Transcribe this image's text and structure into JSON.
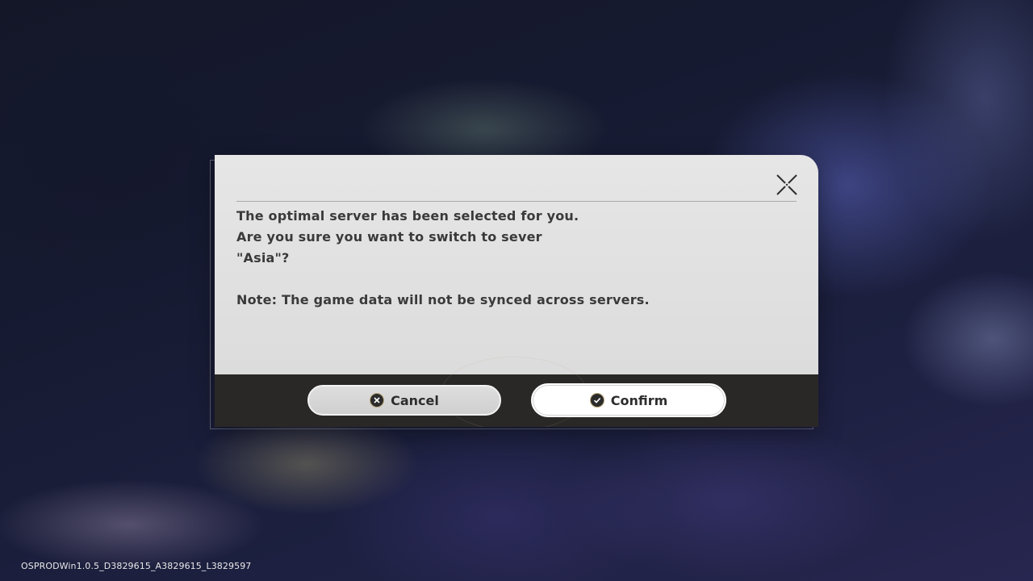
{
  "dialog": {
    "message_lines": [
      "The optimal server has been selected for you.",
      "Are you sure you want to switch to sever",
      "\"Asia\"?"
    ],
    "note": "Note: The game data will not be synced across servers.",
    "close_icon": "close-icon",
    "cancel_label": "Cancel",
    "cancel_icon": "x-circle-icon",
    "confirm_label": "Confirm",
    "confirm_icon": "check-circle-icon"
  },
  "footer": {
    "version": "OSPRODWin1.0.5_D3829615_A3829615_L3829597"
  },
  "colors": {
    "dialog_body": "#e0e0e0",
    "dialog_footer": "#2a2826",
    "text": "#3a3a3a",
    "button_icon_ring": "#b9a67a"
  }
}
